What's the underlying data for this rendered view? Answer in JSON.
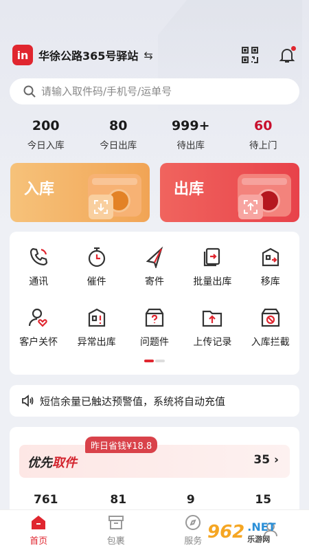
{
  "header": {
    "logo_text": "in",
    "station_name": "华徐公路365号驿站",
    "swap_icon": "⇆",
    "scan_icon": "qr-code-icon",
    "bell_icon": "bell-icon"
  },
  "search": {
    "placeholder": "请输入取件码/手机号/运单号"
  },
  "stats": [
    {
      "value": "200",
      "label": "今日入库"
    },
    {
      "value": "80",
      "label": "今日出库"
    },
    {
      "value": "999+",
      "label": "待出库"
    },
    {
      "value": "60",
      "label": "待上门"
    }
  ],
  "cards": {
    "in_label": "入库",
    "out_label": "出库"
  },
  "grid": [
    {
      "label": "通讯",
      "icon": "phone-icon"
    },
    {
      "label": "催件",
      "icon": "timer-icon"
    },
    {
      "label": "寄件",
      "icon": "send-icon"
    },
    {
      "label": "批量出库",
      "icon": "batch-out-icon"
    },
    {
      "label": "移库",
      "icon": "move-storage-icon"
    },
    {
      "label": "客户关怀",
      "icon": "customer-care-icon"
    },
    {
      "label": "异常出库",
      "icon": "abnormal-out-icon"
    },
    {
      "label": "问题件",
      "icon": "problem-parcel-icon"
    },
    {
      "label": "上传记录",
      "icon": "upload-record-icon"
    },
    {
      "label": "入库拦截",
      "icon": "intercept-icon"
    }
  ],
  "notice": {
    "text": "短信余量已触达预警值，系统将自动充值"
  },
  "priority": {
    "title_a": "优先",
    "title_b": "取件",
    "save_tag": "昨日省钱¥18.8",
    "count": "35",
    "numbers": [
      "761",
      "81",
      "9",
      "15"
    ]
  },
  "nav": [
    {
      "label": "首页",
      "icon": "home-icon",
      "active": true
    },
    {
      "label": "包裹",
      "icon": "package-icon",
      "active": false
    },
    {
      "label": "服务",
      "icon": "compass-icon",
      "active": false
    },
    {
      "label": "",
      "icon": "me-icon",
      "active": false
    }
  ],
  "watermark": {
    "logo": "962",
    "net": ".NET",
    "cn": "乐游网"
  },
  "colors": {
    "brand_red": "#e0262f",
    "in_orange": "#f1a455",
    "out_red": "#e8424a"
  }
}
